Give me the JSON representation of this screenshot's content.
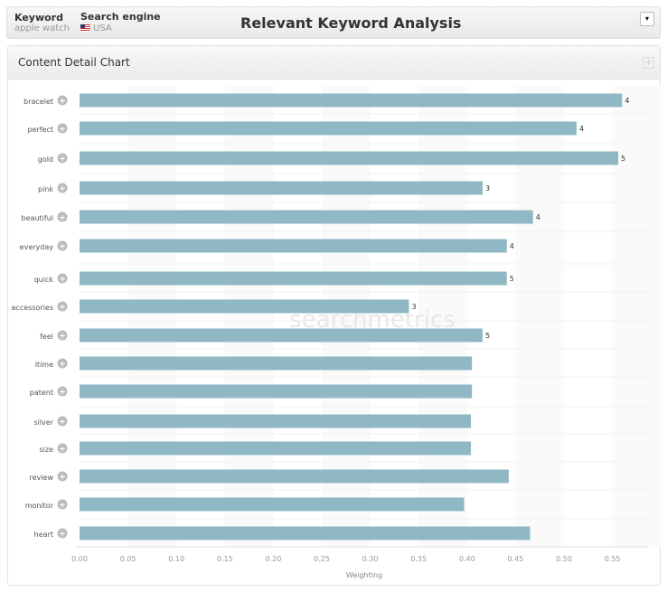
{
  "header": {
    "keyword_label": "Keyword",
    "keyword_value": "apple watch",
    "engine_label": "Search engine",
    "engine_value": "USA",
    "title": "Relevant Keyword Analysis"
  },
  "panel": {
    "title": "Content Detail Chart"
  },
  "chart_data": {
    "type": "bar",
    "orientation": "horizontal",
    "xlabel": "Weighting",
    "xlim": [
      0,
      0.585
    ],
    "ticks": [
      "0.00",
      "0.05",
      "0.10",
      "0.15",
      "0.20",
      "0.25",
      "0.30",
      "0.35",
      "0.40",
      "0.45",
      "0.50",
      "0.55"
    ],
    "categories": [
      "bracelet",
      "perfect",
      "gold",
      "pink",
      "beautiful",
      "everyday",
      "quick",
      "accessories",
      "feel",
      "itime",
      "patent",
      "silver",
      "size",
      "review",
      "monitor",
      "heart"
    ],
    "values": [
      0.56,
      0.513,
      0.556,
      0.416,
      0.468,
      0.441,
      0.441,
      0.34,
      0.416,
      0.405,
      0.405,
      0.404,
      0.404,
      0.443,
      0.397,
      0.465
    ],
    "labels": [
      "4",
      "4",
      "5",
      "3",
      "4",
      "4",
      "5",
      "3",
      "5",
      "",
      "",
      "",
      "",
      "",
      "",
      ""
    ],
    "color": "#8fb8c4",
    "watermark": "searchmetrics"
  }
}
